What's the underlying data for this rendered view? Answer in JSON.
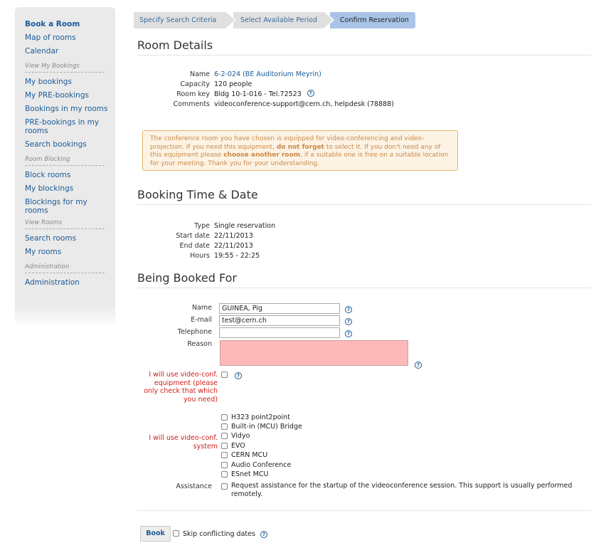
{
  "sidebar": {
    "book_room": "Book a Room",
    "map_rooms": "Map of rooms",
    "calendar": "Calendar",
    "sec_bookings": "View My Bookings",
    "my_bookings": "My bookings",
    "my_prebookings": "My PRE-bookings",
    "bookings_in_rooms": "Bookings in my rooms",
    "prebookings_in_rooms": "PRE-bookings in my rooms",
    "search_bookings": "Search bookings",
    "sec_blocking": "Room Blocking",
    "block_rooms": "Block rooms",
    "my_blockings": "My blockings",
    "blockings_for_rooms": "Blockings for my rooms",
    "sec_view_rooms": "View Rooms",
    "search_rooms": "Search rooms",
    "my_rooms": "My rooms",
    "sec_admin": "Administration",
    "administration": "Administration"
  },
  "steps": [
    "Specify Search Criteria",
    "Select Available Period",
    "Confirm Reservation"
  ],
  "room_details": {
    "heading": "Room Details",
    "name_label": "Name",
    "name": "6-2-024 (BE Auditorium Meyrin)",
    "capacity_label": "Capacity",
    "capacity": "120 people",
    "key_label": "Room key",
    "key": "Bldg 10-1-016 - Tel.72523",
    "comments_label": "Comments",
    "comments": "videoconference-support@cern.ch, helpdesk (78888)"
  },
  "warning": {
    "part1": "The conference room you have chosen is equipped for video-conferencing and video-projection. If you need this equipment, ",
    "bold1": "do not forget",
    "part2": " to select it. If you don't need any of this equipment please ",
    "bold2": "choose another room",
    "part3": ", if a suitable one is free on a suitable location for your meeting. Thank you for your understanding."
  },
  "booking_time": {
    "heading": "Booking Time & Date",
    "type_label": "Type",
    "type": "Single reservation",
    "start_label": "Start date",
    "start": "22/11/2013",
    "end_label": "End date",
    "end": "22/11/2013",
    "hours_label": "Hours",
    "hours": "19:55 - 22:25"
  },
  "booked_for": {
    "heading": "Being Booked For",
    "name_label": "Name",
    "name": "GUINEA, Pig",
    "email_label": "E-mail",
    "email": "test@cern.ch",
    "phone_label": "Telephone",
    "phone": "",
    "reason_label": "Reason",
    "vc_equipment_label": "I will use video-conf. equipment (please only check that which you need)",
    "vc_system_label": "I will use video-conf. system",
    "systems": [
      "H323 point2point",
      "Built-in (MCU) Bridge",
      "Vidyo",
      "EVO",
      "CERN MCU",
      "Audio Conference",
      "ESnet MCU"
    ],
    "assistance_label": "Assistance",
    "assistance_text": "Request assistance for the startup of the videoconference session. This support is usually performed remotely."
  },
  "footer": {
    "book": "Book",
    "skip": "Skip conflicting dates"
  },
  "help_glyph": "?"
}
